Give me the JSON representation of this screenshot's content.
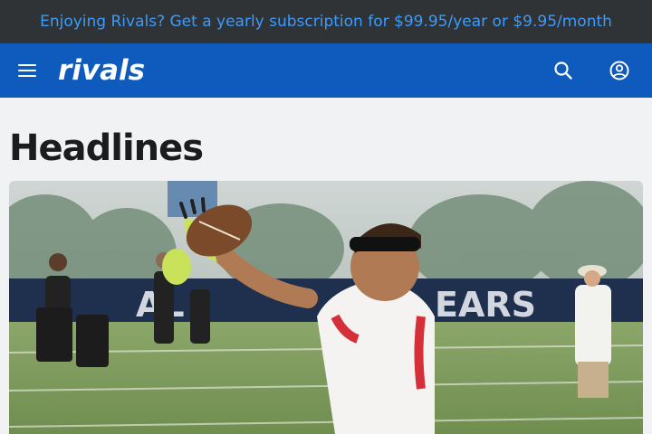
{
  "promo_banner": {
    "text": "Enjoying Rivals? Get a yearly subscription for $99.95/year or $9.95/month",
    "link_color": "#3a9bff",
    "background": "#2f3336"
  },
  "navbar": {
    "background": "#0f5bbd",
    "logo_text": "rivals",
    "menu_icon": "hamburger-icon",
    "search_icon": "search-icon",
    "account_icon": "account-circle-icon"
  },
  "main": {
    "section_title": "Headlines",
    "hero_image": {
      "subject": "football-player-catching-ball"
    }
  }
}
